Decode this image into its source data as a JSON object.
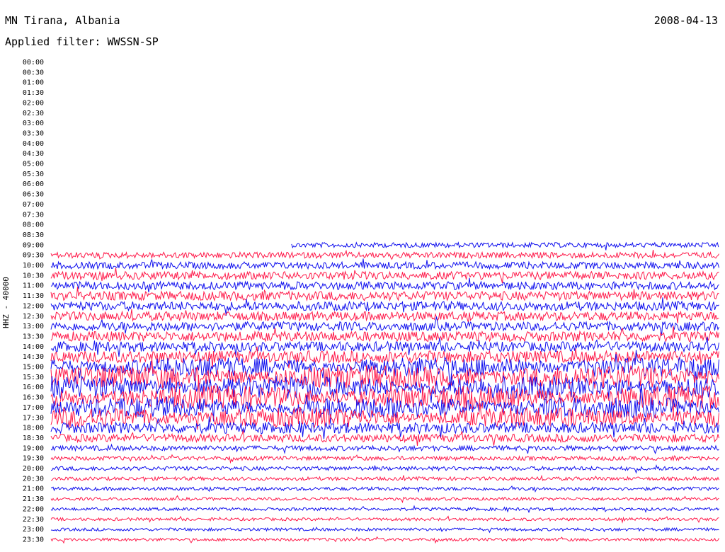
{
  "header": {
    "station": "MN Tirana, Albania",
    "date": "2008-04-13",
    "filter": "Applied filter: WWSSN-SP"
  },
  "chart_data": {
    "type": "line",
    "title": "MN Tirana, Albania",
    "subtitle": "Applied filter: WWSSN-SP",
    "date": "2008-04-13",
    "ylabel": "HHZ - 40000",
    "xlabel": "",
    "y_tick_labels": [
      "00:00",
      "00:30",
      "01:00",
      "01:30",
      "02:00",
      "02:30",
      "03:00",
      "03:30",
      "04:00",
      "04:30",
      "05:00",
      "05:30",
      "06:00",
      "06:30",
      "07:00",
      "07:30",
      "08:00",
      "08:30",
      "09:00",
      "09:30",
      "10:00",
      "10:30",
      "11:00",
      "11:30",
      "12:00",
      "12:30",
      "13:00",
      "13:30",
      "14:00",
      "14:30",
      "15:00",
      "15:30",
      "16:00",
      "16:30",
      "17:00",
      "17:30",
      "18:00",
      "18:30",
      "19:00",
      "19:30",
      "20:00",
      "20:30",
      "21:00",
      "21:30",
      "22:00",
      "22:30",
      "23:00",
      "23:30"
    ],
    "trace_colors": [
      "#ff1a4a",
      "#1010ee"
    ],
    "data_start": "09:00",
    "trace_rows": [
      {
        "row": "09:00",
        "start_fraction": 0.36,
        "amplitude": 0.5,
        "color": "#1010ee"
      },
      {
        "row": "09:30",
        "amplitude": 0.6,
        "color": "#ff1a4a"
      },
      {
        "row": "10:00",
        "amplitude": 0.7,
        "color": "#1010ee"
      },
      {
        "row": "10:30",
        "amplitude": 0.8,
        "color": "#ff1a4a"
      },
      {
        "row": "11:00",
        "amplitude": 0.8,
        "color": "#1010ee"
      },
      {
        "row": "11:30",
        "amplitude": 0.9,
        "color": "#ff1a4a"
      },
      {
        "row": "12:00",
        "amplitude": 0.9,
        "color": "#1010ee"
      },
      {
        "row": "12:30",
        "amplitude": 0.9,
        "color": "#ff1a4a"
      },
      {
        "row": "13:00",
        "amplitude": 0.9,
        "color": "#1010ee"
      },
      {
        "row": "13:30",
        "amplitude": 1.0,
        "color": "#ff1a4a"
      },
      {
        "row": "14:00",
        "amplitude": 1.0,
        "color": "#1010ee"
      },
      {
        "row": "14:30",
        "amplitude": 1.2,
        "color": "#ff1a4a"
      },
      {
        "row": "15:00",
        "amplitude": 1.4,
        "color": "#1010ee"
      },
      {
        "row": "15:30",
        "amplitude": 1.6,
        "color": "#ff1a4a"
      },
      {
        "row": "16:00",
        "amplitude": 1.6,
        "color": "#1010ee"
      },
      {
        "row": "16:30",
        "amplitude": 1.6,
        "color": "#ff1a4a"
      },
      {
        "row": "17:00",
        "amplitude": 1.5,
        "color": "#1010ee"
      },
      {
        "row": "17:30",
        "amplitude": 1.4,
        "color": "#ff1a4a"
      },
      {
        "row": "18:00",
        "amplitude": 1.1,
        "color": "#1010ee"
      },
      {
        "row": "18:30",
        "amplitude": 0.8,
        "color": "#ff1a4a"
      },
      {
        "row": "19:00",
        "amplitude": 0.5,
        "color": "#1010ee"
      },
      {
        "row": "19:30",
        "amplitude": 0.4,
        "color": "#ff1a4a"
      },
      {
        "row": "20:00",
        "amplitude": 0.4,
        "color": "#1010ee"
      },
      {
        "row": "20:30",
        "amplitude": 0.35,
        "color": "#ff1a4a"
      },
      {
        "row": "21:00",
        "amplitude": 0.35,
        "color": "#1010ee"
      },
      {
        "row": "21:30",
        "amplitude": 0.3,
        "color": "#ff1a4a"
      },
      {
        "row": "22:00",
        "amplitude": 0.3,
        "color": "#1010ee"
      },
      {
        "row": "22:30",
        "amplitude": 0.3,
        "color": "#ff1a4a"
      },
      {
        "row": "23:00",
        "amplitude": 0.3,
        "color": "#1010ee"
      },
      {
        "row": "23:30",
        "amplitude": 0.3,
        "color": "#ff1a4a"
      }
    ],
    "grid": false
  }
}
